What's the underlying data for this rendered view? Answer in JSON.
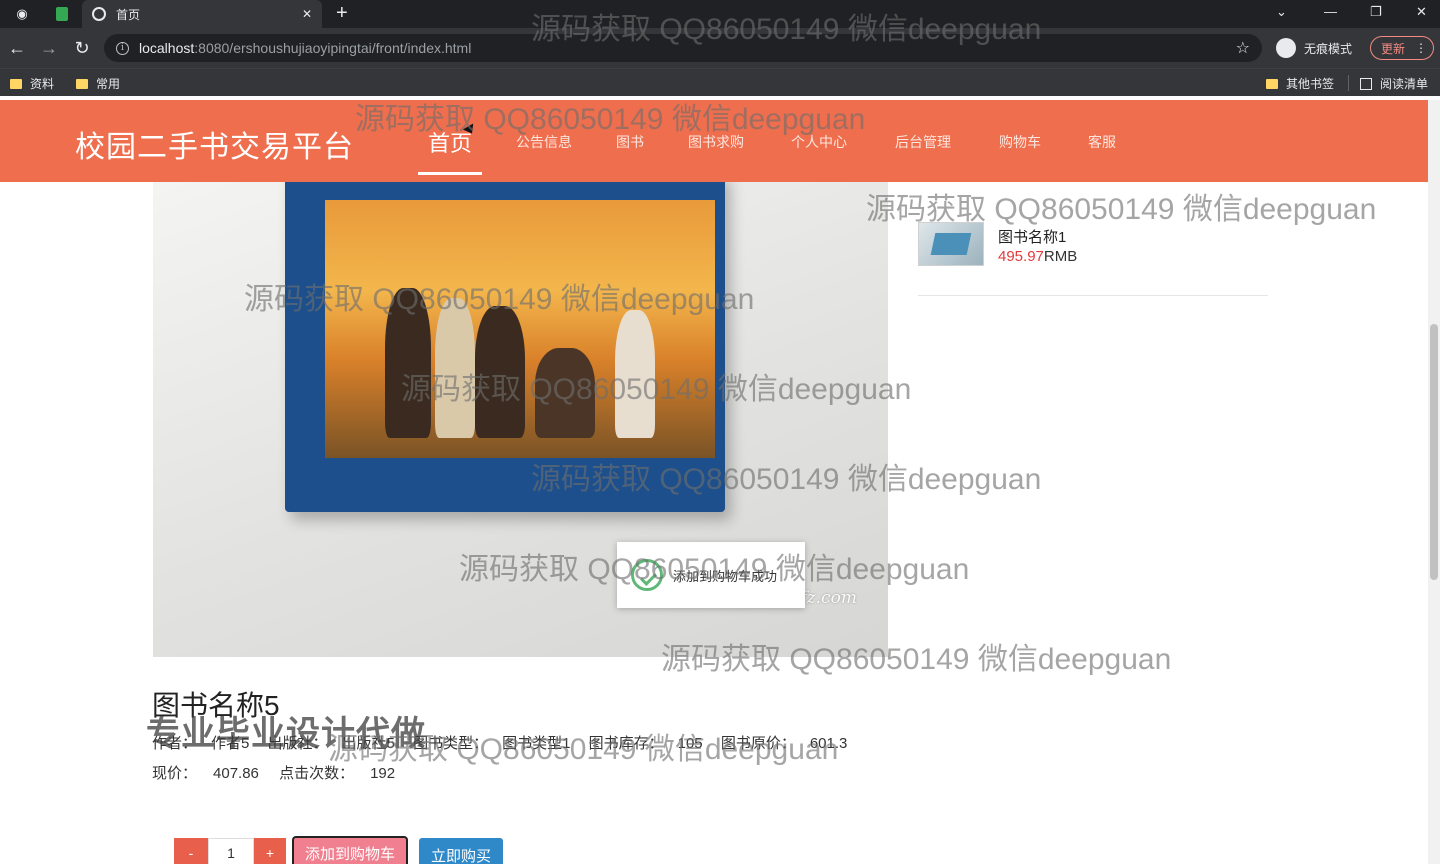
{
  "browser": {
    "tab_title": "首页",
    "url_host": "localhost",
    "url_path": ":8080/ershoushujiaoyipingtai/front/index.html",
    "incognito_label": "无痕模式",
    "update_label": "更新",
    "bookmarks": [
      "资料",
      "常用"
    ],
    "other_bookmarks": "其他书签",
    "reading_list": "阅读清单"
  },
  "site": {
    "brand": "校园二手书交易平台",
    "nav": [
      "首页",
      "公告信息",
      "图书",
      "图书求购",
      "个人中心",
      "后台管理",
      "购物车",
      "客服"
    ],
    "active_nav": "首页",
    "colors": {
      "header": "#ef6e4d",
      "price": "#e4393c",
      "buy": "#2f88c8",
      "cart": "#f08090"
    }
  },
  "product": {
    "photo_watermark": "www.kongfz.com",
    "title": "图书名称5",
    "meta": [
      "作者：",
      "作者5",
      "出版社：",
      "出版社5",
      "图书类型：",
      "图书类型1",
      "图书库存：",
      "105",
      "图书原价：",
      "601.3"
    ],
    "current_price_label": "现价：",
    "current_price": "407.86",
    "clicks_label": "点击次数：",
    "clicks": "192",
    "qty_minus": "-",
    "qty_value": "1",
    "qty_plus": "+",
    "add_to_cart": "添加到购物车",
    "buy_now": "立即购买"
  },
  "toast": {
    "message": "添加到购物车成功"
  },
  "sidebar": {
    "item_title": "图书名称1",
    "item_price": "495.97",
    "item_unit": "RMB"
  },
  "overlays": {
    "watermark": "源码获取 QQ86050149 微信deepguan",
    "promo": "专业毕业设计代做"
  }
}
